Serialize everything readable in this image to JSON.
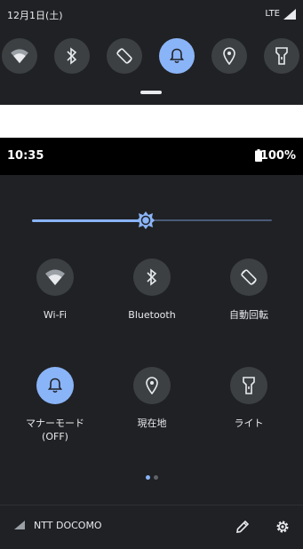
{
  "collapsed_panel": {
    "date": "12月1日(土)",
    "network": "LTE",
    "tiles": [
      {
        "id": "wifi",
        "icon": "wifi-icon",
        "active": false
      },
      {
        "id": "bluetooth",
        "icon": "bluetooth-icon",
        "active": false
      },
      {
        "id": "auto-rotate",
        "icon": "rotate-icon",
        "active": false
      },
      {
        "id": "manner-mode",
        "icon": "bell-icon",
        "active": true
      },
      {
        "id": "location",
        "icon": "location-icon",
        "active": false
      },
      {
        "id": "flashlight",
        "icon": "flashlight-icon",
        "active": false
      }
    ]
  },
  "expanded_panel": {
    "status_bar": {
      "time": "10:35",
      "battery": "100%"
    },
    "brightness": {
      "level": 0.47,
      "icon": "brightness-icon"
    },
    "tiles": [
      {
        "label": "Wi-Fi",
        "icon": "wifi-icon",
        "active": false
      },
      {
        "label": "Bluetooth",
        "icon": "bluetooth-icon",
        "active": false
      },
      {
        "label": "自動回転",
        "icon": "rotate-icon",
        "active": false
      },
      {
        "label": "マナーモード",
        "sublabel": "(OFF)",
        "icon": "bell-icon",
        "active": true
      },
      {
        "label": "現在地",
        "icon": "location-icon",
        "active": false
      },
      {
        "label": "ライト",
        "icon": "flashlight-icon",
        "active": false
      }
    ],
    "pager": {
      "pages": 2,
      "current": 1
    },
    "footer": {
      "carrier": "NTT DOCOMO",
      "edit_icon": "pencil-icon",
      "settings_icon": "gear-icon"
    }
  },
  "colors": {
    "panel_bg": "#202124",
    "tile_inactive": "#3c4043",
    "tile_active": "#8ab4f8",
    "text": "#e8eaed",
    "status_bar_bg": "#000000"
  }
}
